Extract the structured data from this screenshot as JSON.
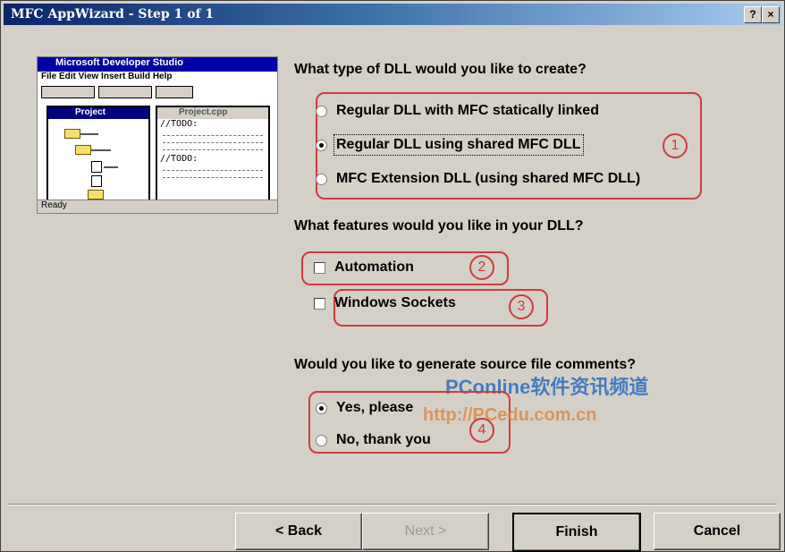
{
  "window": {
    "title": "MFC AppWizard - Step 1 of 1",
    "help_btn": "?",
    "close_btn": "×"
  },
  "preview": {
    "title": "Microsoft Developer Studio",
    "menu": "File Edit View Insert Build Help",
    "project_title": "Project",
    "editor_title": "Project.cpp",
    "code_line1": "//TODO:",
    "code_line2": "//TODO:",
    "status": "Ready"
  },
  "q1": {
    "label": "What type of DLL would you like to create?",
    "options": [
      {
        "label": "Regular DLL with MFC statically linked",
        "selected": false
      },
      {
        "label": "Regular DLL using shared MFC DLL",
        "selected": true
      },
      {
        "label": "MFC Extension DLL (using shared MFC DLL)",
        "selected": false
      }
    ]
  },
  "q2": {
    "label": "What features would you like in your DLL?",
    "options": [
      {
        "label": "Automation",
        "checked": false
      },
      {
        "label": "Windows Sockets",
        "checked": false
      }
    ]
  },
  "q3": {
    "label": "Would you like to generate source file comments?",
    "options": [
      {
        "label": "Yes, please",
        "selected": true
      },
      {
        "label": "No, thank you",
        "selected": false
      }
    ]
  },
  "annotations": {
    "n1": "1",
    "n2": "2",
    "n3": "3",
    "n4": "4"
  },
  "watermark": {
    "line1": "PConline软件资讯频道",
    "line2": "http://PCedu.com.cn"
  },
  "buttons": {
    "back": "< Back",
    "next": "Next >",
    "finish": "Finish",
    "cancel": "Cancel"
  }
}
